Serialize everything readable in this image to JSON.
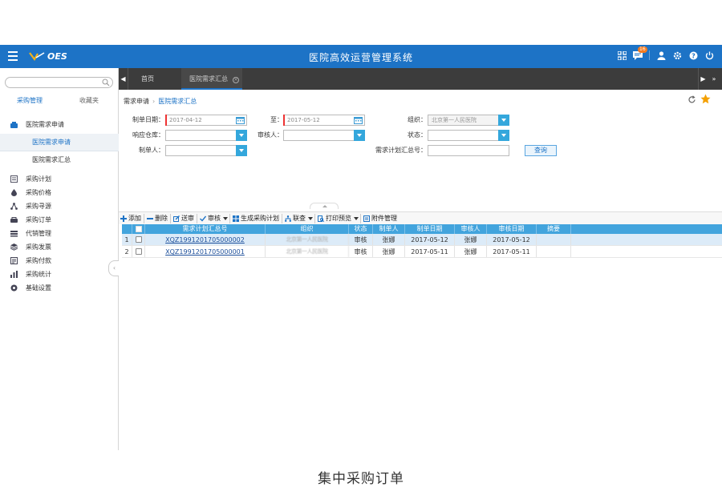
{
  "app": {
    "logo_text": "OES",
    "title": "医院高效运营管理系统",
    "notification_count": "16",
    "brand_color": "#1d73c6"
  },
  "sidebar": {
    "search_placeholder": "",
    "tabs": [
      {
        "label": "采购管理",
        "active": true
      },
      {
        "label": "收藏夹",
        "active": false
      }
    ],
    "group": {
      "label": "医院需求申请",
      "icon": "inbox-icon"
    },
    "subitems": [
      {
        "label": "医院需求申请",
        "active": true
      },
      {
        "label": "医院需求汇总",
        "active": false
      }
    ],
    "items": [
      {
        "label": "采购计划",
        "icon": "plan-icon"
      },
      {
        "label": "采购价格",
        "icon": "price-icon"
      },
      {
        "label": "采购寻源",
        "icon": "source-icon"
      },
      {
        "label": "采购订单",
        "icon": "order-icon"
      },
      {
        "label": "代销管理",
        "icon": "consign-icon"
      },
      {
        "label": "采购发票",
        "icon": "invoice-icon"
      },
      {
        "label": "采购付款",
        "icon": "payment-icon"
      },
      {
        "label": "采购统计",
        "icon": "stats-icon"
      },
      {
        "label": "基础设置",
        "icon": "settings-icon"
      }
    ]
  },
  "tabs": {
    "home": "首页",
    "active": "医院需求汇总"
  },
  "breadcrumb": {
    "root": "需求申请",
    "current": "医院需求汇总"
  },
  "form": {
    "date_from_label": "制单日期：",
    "date_from_value": "2017-04-12",
    "date_to_label": "至：",
    "date_to_value": "2017-05-12",
    "org_label": "组织：",
    "org_value": "北京第一人民医院",
    "warehouse_label": "响应仓库：",
    "warehouse_value": "",
    "auditor_label": "审核人：",
    "auditor_value": "",
    "status_label": "状态：",
    "status_value": "",
    "maker_label": "制单人：",
    "maker_value": "",
    "code_label": "需求计划汇总号：",
    "code_value": "",
    "query_button": "查询"
  },
  "toolbar": {
    "add": "添加",
    "delete": "删除",
    "submit": "送审",
    "audit": "审核",
    "generate": "生成采购计划",
    "query_link": "联查",
    "print": "打印预览",
    "attachments": "附件管理"
  },
  "grid": {
    "columns": [
      "需求计划汇总号",
      "组织",
      "状态",
      "制单人",
      "制单日期",
      "审核人",
      "审核日期",
      "摘要"
    ],
    "rows": [
      {
        "num": "1",
        "code": "XQZ1991201705000002",
        "org": "北京第一人民医院",
        "status": "审核",
        "maker": "张娜",
        "date": "2017-05-12",
        "auditor": "张娜",
        "audit_date": "2017-05-12",
        "summary": ""
      },
      {
        "num": "2",
        "code": "XQZ1991201705000001",
        "org": "北京第一人民医院",
        "status": "审核",
        "maker": "张娜",
        "date": "2017-05-11",
        "auditor": "张娜",
        "audit_date": "2017-05-11",
        "summary": ""
      }
    ],
    "header_color": "#42a4dd"
  },
  "caption": "集中采购订单"
}
